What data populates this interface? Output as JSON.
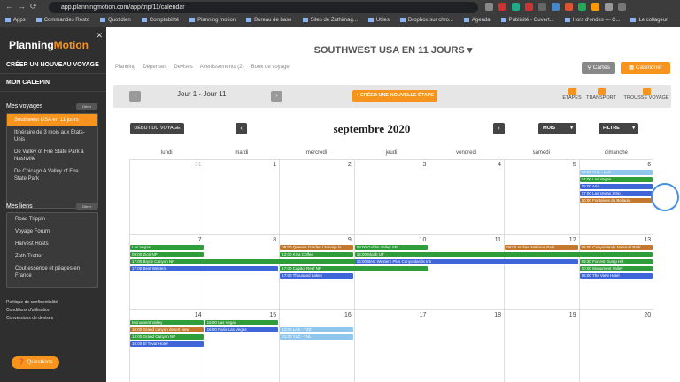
{
  "browser": {
    "url": "app.planningmotion.com/app/trip/11/calendar",
    "bookmarks": [
      "Apps",
      "Commandes Resto",
      "Quotidien",
      "Comptabilité",
      "Planning motion",
      "Bureau de base",
      "Sites de Zathimag...",
      "Utiles",
      "Dropbox sur chro...",
      "Agenda",
      "Publicité - Ouvert...",
      "Hors d'ondes — C...",
      "Le collageur"
    ]
  },
  "sidebar": {
    "logo_a": "Planning",
    "logo_b": "Motion",
    "close": "✕",
    "create": "CRÉER UN NOUVEAU VOYAGE",
    "calepin": "MON CALEPIN",
    "voyages_label": "Mes voyages",
    "voyages_btn": "Gérer",
    "trips": [
      "Southwest USA en 11 jours",
      "Itinéraire de 3 mois aux États-Unis",
      "De Valley of Fire State Park à Nashville",
      "De Chicago à Valley of Fire State Park"
    ],
    "liens_label": "Mes liens",
    "liens_btn": "Gérer",
    "links": [
      "Road Trippin",
      "Voyage Forum",
      "Harvest Hosts",
      "Zath-Trotter",
      "Cout essence et péages en France"
    ],
    "footer": [
      "Politique de confidentialité",
      "Conditions d'utilisation",
      "Conversions de devises"
    ],
    "questions": "Questions"
  },
  "main": {
    "title": "SOUTHWEST USA EN 11 JOURS ▾",
    "tabs": [
      "Planning",
      "Dépenses",
      "Devises",
      "Avertissements (2)",
      "Book de voyage"
    ],
    "cartes": "Cartes",
    "calendrier": "Calendrier",
    "jours": "Jour 1 - Jour 11",
    "new_step": "+ CRÉER UNE NOUVELLE ÉTAPE",
    "tools": [
      "ÉTAPES",
      "TRANSPORT",
      "TROUSSE VOYAGE"
    ],
    "debut": "DÉBUT DU VOYAGE",
    "month": "septembre 2020",
    "mois": "MOIS",
    "filtre": "FILTRE",
    "weekdays": [
      "lundi",
      "mardi",
      "mercredi",
      "jeudi",
      "vendredi",
      "samedi",
      "dimanche"
    ],
    "weeks": [
      [
        "31",
        "1",
        "2",
        "3",
        "4",
        "5",
        "6"
      ],
      [
        "7",
        "8",
        "9",
        "10",
        "11",
        "12",
        "13"
      ],
      [
        "14",
        "15",
        "16",
        "17",
        "18",
        "19",
        "20"
      ]
    ]
  },
  "events": [
    {
      "t": "12:00 YUL - LAS",
      "c": "lb",
      "w": 0,
      "d": 6,
      "r": 0
    },
    {
      "t": "14:00 Las Vegas",
      "c": "g",
      "w": 0,
      "d": 6,
      "r": 1
    },
    {
      "t": "15:00 Aria",
      "c": "b",
      "w": 0,
      "d": 6,
      "r": 2
    },
    {
      "t": "17:00 Las Vegas Strip",
      "c": "b",
      "w": 0,
      "d": 6,
      "r": 3
    },
    {
      "t": "20:00 Fontaines du Bellagio",
      "c": "o",
      "w": 0,
      "d": 6,
      "r": 4
    },
    {
      "t": "Las Vegas",
      "c": "g",
      "w": 1,
      "d": 0,
      "r": 0
    },
    {
      "t": "09:00 Zion NP",
      "c": "g",
      "w": 1,
      "d": 0,
      "r": 1
    },
    {
      "t": "17:00 Bryce Canyon NP",
      "c": "g",
      "w": 1,
      "d": 0,
      "r": 2,
      "span": 4
    },
    {
      "t": "17:00 Best Western",
      "c": "b",
      "w": 1,
      "d": 0,
      "r": 3,
      "span": 2
    },
    {
      "t": "08:00 Queens Garden / Navajo lo",
      "c": "o",
      "w": 1,
      "d": 2,
      "r": 0
    },
    {
      "t": "12:00 Kiva Coffee",
      "c": "g",
      "w": 1,
      "d": 2,
      "r": 1
    },
    {
      "t": "17:00 Capitol Reef NP",
      "c": "g",
      "w": 1,
      "d": 2,
      "r": 3,
      "span": 2
    },
    {
      "t": "17:00 Thousand Lakes",
      "c": "b",
      "w": 1,
      "d": 2,
      "r": 4
    },
    {
      "t": "09:00 Goblin Valley SP",
      "c": "g",
      "w": 1,
      "d": 3,
      "r": 0
    },
    {
      "t": "15:00 Moab UT",
      "c": "g",
      "w": 1,
      "d": 3,
      "r": 1,
      "span": 4
    },
    {
      "t": "16:00 Best Western Plus Canyonlands Inn",
      "c": "b",
      "w": 1,
      "d": 3,
      "r": 2,
      "span": 3
    },
    {
      "t": "08:00 Arches National Park",
      "c": "o",
      "w": 1,
      "d": 5,
      "r": 0
    },
    {
      "t": "06:00 Canyonlands National Park",
      "c": "o",
      "w": 1,
      "d": 6,
      "r": 0
    },
    {
      "t": "09:30 Forrest Gump Hill",
      "c": "g",
      "w": 1,
      "d": 6,
      "r": 2
    },
    {
      "t": "10:00 Monument Valley",
      "c": "g",
      "w": 1,
      "d": 6,
      "r": 3
    },
    {
      "t": "16:00 The View Hotel",
      "c": "b",
      "w": 1,
      "d": 6,
      "r": 4
    },
    {
      "t": "Monument Valley",
      "c": "g",
      "w": 2,
      "d": 0,
      "r": 0
    },
    {
      "t": "10:00 Grand canyon desert view",
      "c": "o",
      "w": 2,
      "d": 0,
      "r": 1
    },
    {
      "t": "13:00 Grand Canyon NP",
      "c": "g",
      "w": 2,
      "d": 0,
      "r": 2
    },
    {
      "t": "16:00 El Tovar Hotel",
      "c": "b",
      "w": 2,
      "d": 0,
      "r": 3
    },
    {
      "t": "15:00 Las Vegas",
      "c": "g",
      "w": 2,
      "d": 1,
      "r": 0
    },
    {
      "t": "16:00 Paris Las Vegas",
      "c": "b",
      "w": 2,
      "d": 1,
      "r": 1
    },
    {
      "t": "12:00 LAS - YZZ",
      "c": "lb",
      "w": 2,
      "d": 2,
      "r": 1
    },
    {
      "t": "21:00 YZZ - YUL",
      "c": "lb",
      "w": 2,
      "d": 2,
      "r": 2
    }
  ]
}
